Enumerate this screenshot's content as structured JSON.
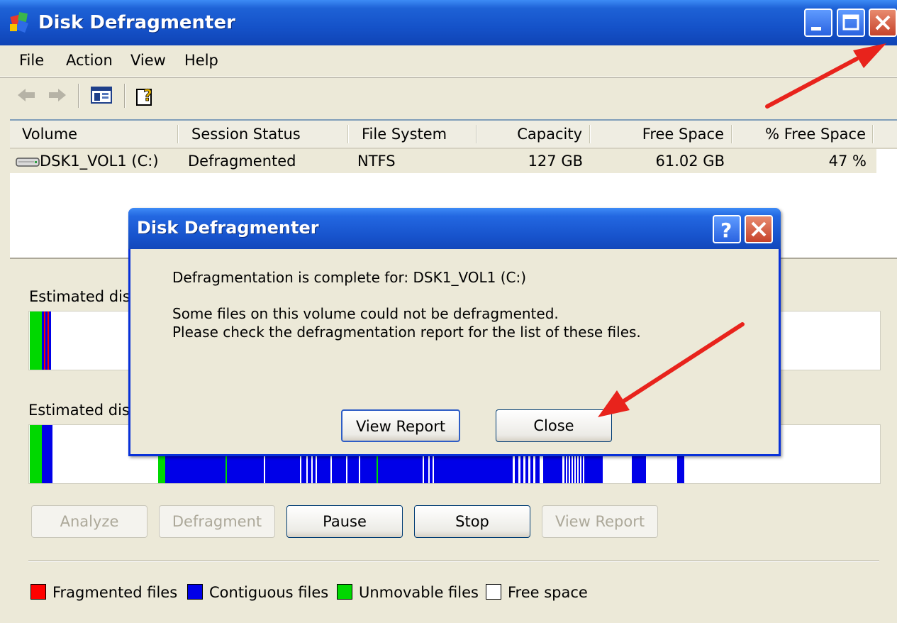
{
  "window": {
    "title": "Disk Defragmenter"
  },
  "menu": [
    "File",
    "Action",
    "View",
    "Help"
  ],
  "icons": {
    "app": "disk-defrag-app-icon",
    "back": "back-arrow-icon",
    "forward": "forward-arrow-icon",
    "show_hide": "show-hide-console-tree-icon",
    "help": "help-topics-icon",
    "drive": "hard-drive-icon"
  },
  "columns": [
    "Volume",
    "Session Status",
    "File System",
    "Capacity",
    "Free Space",
    "% Free Space"
  ],
  "volumes": [
    {
      "volume": "DSK1_VOL1 (C:)",
      "status": "Defragmented",
      "fs": "NTFS",
      "capacity": "127 GB",
      "free": "61.02 GB",
      "pct_free": "47 %"
    }
  ],
  "labels": {
    "before": "Estimated disk",
    "after": "Estimated disk"
  },
  "buttons": {
    "analyze": "Analyze",
    "defragment": "Defragment",
    "pause": "Pause",
    "stop": "Stop",
    "view_report": "View Report"
  },
  "legend": [
    {
      "label": "Fragmented files",
      "color": "#FF0000"
    },
    {
      "label": "Contiguous files",
      "color": "#0000E8"
    },
    {
      "label": "Unmovable files",
      "color": "#00D800"
    },
    {
      "label": "Free space",
      "color": "#FFFFFF"
    }
  ],
  "dialog": {
    "title": "Disk Defragmenter",
    "line1": "Defragmentation is complete for: DSK1_VOL1 (C:)",
    "line2": "Some files on this volume could not be defragmented.",
    "line3": "Please check the defragmentation report for the list of these files.",
    "view_report": "View Report",
    "close": "Close"
  },
  "colors": {
    "titlebar": "#1552C9",
    "dialog_border": "#0831D9",
    "annotation_arrow": "#E8231C"
  }
}
